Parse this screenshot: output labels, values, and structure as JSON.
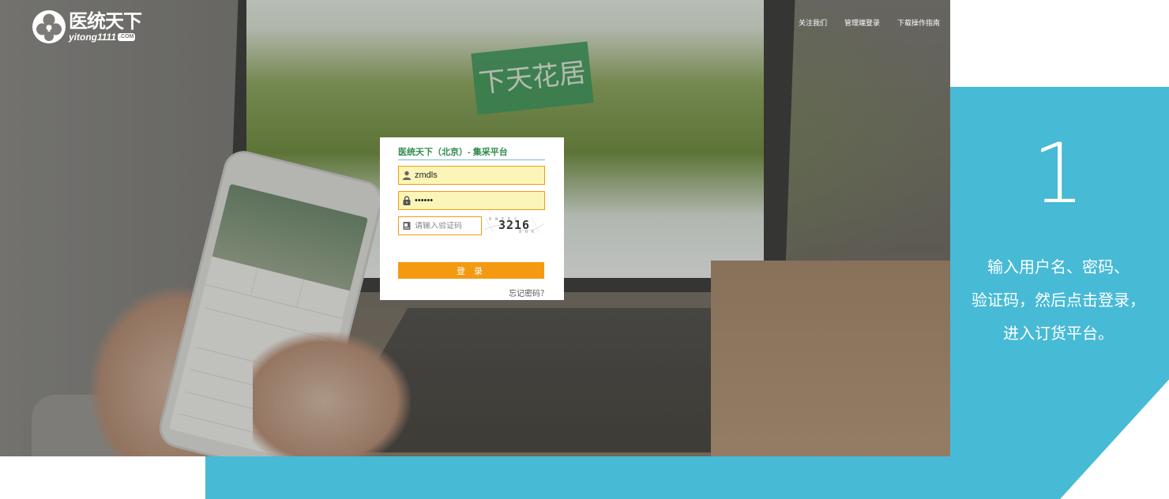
{
  "logo": {
    "title": "医统天下",
    "subtitle": "yitong1111",
    "com": ".COM"
  },
  "nav": {
    "items": [
      "关注我们",
      "管理端登录",
      "下载操作指南"
    ]
  },
  "login": {
    "title": "医统天下（北京）- 集采平台",
    "username": "zmdls",
    "password": "••••••",
    "captcha_placeholder": "请输入验证码",
    "captcha_code": "3216",
    "submit_label": "登 录",
    "forgot_label": "忘记密码？"
  },
  "hero": {
    "screen_banner": "下天花居"
  },
  "side": {
    "step_number": "1",
    "lines": [
      "输入用户名、密码、",
      "验证码，然后点击登录，",
      "进入订货平台。"
    ]
  },
  "colors": {
    "accent_orange": "#f39a12",
    "panel_blue": "#47bad6",
    "brand_green": "#2f8a4b",
    "input_fill": "#fbf6b7"
  },
  "icons": [
    "user-icon",
    "lock-icon",
    "captcha-icon"
  ]
}
